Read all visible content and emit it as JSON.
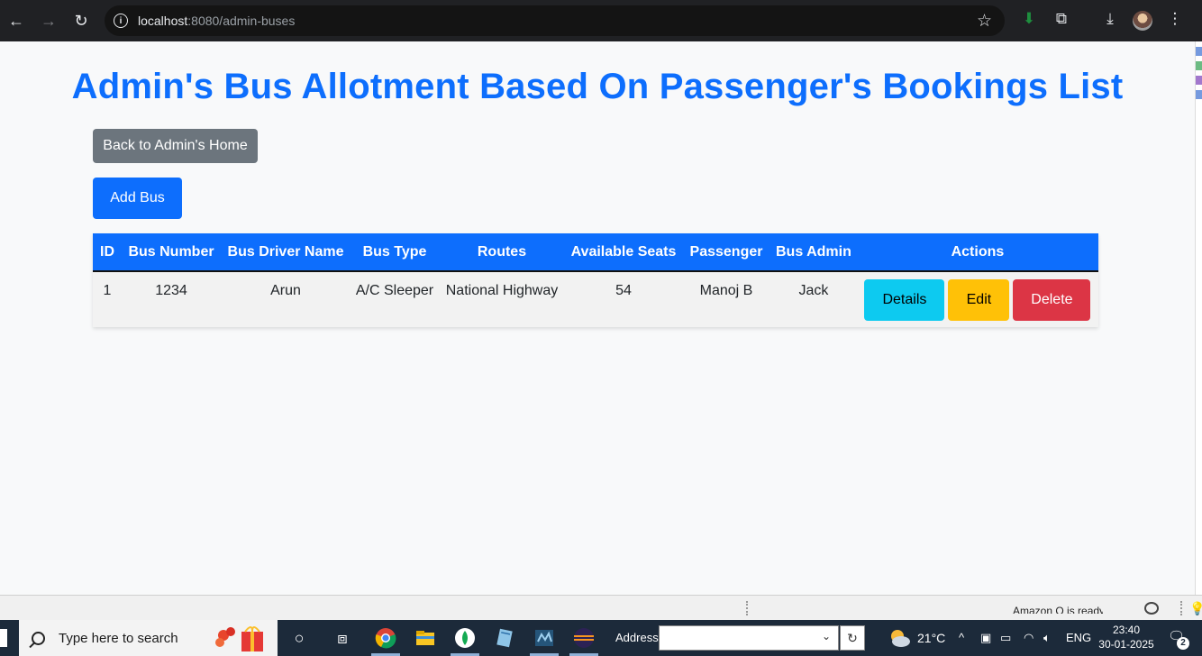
{
  "browser": {
    "url_host": "localhost",
    "url_path": ":8080/admin-buses"
  },
  "page": {
    "title": "Admin's Bus Allotment Based On Passenger's Bookings List",
    "back_button": "Back to Admin's Home",
    "add_button": "Add Bus"
  },
  "table": {
    "headers": [
      "ID",
      "Bus Number",
      "Bus Driver Name",
      "Bus Type",
      "Routes",
      "Available Seats",
      "Passenger",
      "Bus Admin",
      "Actions"
    ],
    "rows": [
      {
        "id": "1",
        "bus_number": "1234",
        "driver": "Arun",
        "bus_type": "A/C Sleeper",
        "route": "National Highway",
        "seats": "54",
        "passenger": "Manoj B",
        "admin": "Jack",
        "actions": [
          "Details",
          "Edit",
          "Delete"
        ]
      }
    ]
  },
  "statusbar": {
    "text": "Amazon Q is ready"
  },
  "taskbar": {
    "search_placeholder": "Type here to search",
    "address_label": "Address",
    "temperature": "21°C",
    "language": "ENG",
    "time": "23:40",
    "date": "30-01-2025",
    "notification_count": "2"
  },
  "colors": {
    "primary": "#0d6efd",
    "secondary": "#6c757d",
    "info": "#0dcaf0",
    "warning": "#ffc107",
    "danger": "#dc3545"
  }
}
